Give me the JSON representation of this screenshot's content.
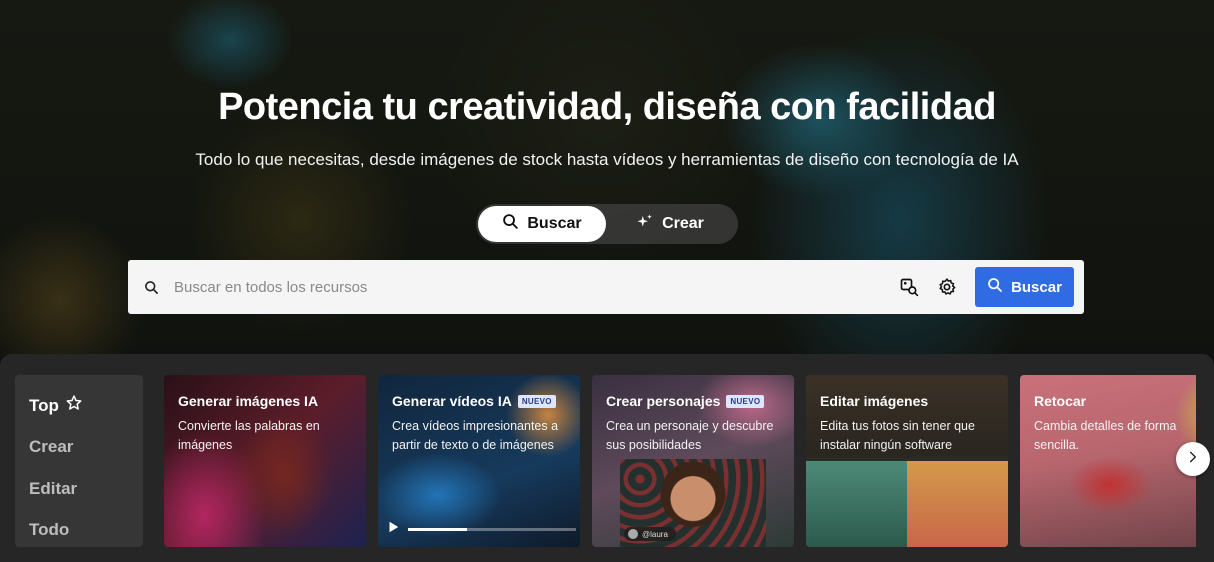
{
  "hero": {
    "title": "Potencia tu creatividad, diseña con facilidad",
    "subtitle": "Todo lo que necesitas, desde imágenes de stock hasta vídeos y herramientas de diseño con tecnología de IA"
  },
  "mode_toggle": {
    "search_label": "Buscar",
    "create_label": "Crear",
    "active": "Buscar"
  },
  "search": {
    "placeholder": "Buscar en todos los recursos",
    "value": "",
    "button_label": "Buscar",
    "button_color": "#2f6be3"
  },
  "categories": [
    {
      "label": "Top",
      "active": true
    },
    {
      "label": "Crear",
      "active": false
    },
    {
      "label": "Editar",
      "active": false
    },
    {
      "label": "Todo",
      "active": false
    }
  ],
  "cards": [
    {
      "title": "Generar imágenes IA",
      "badge": "",
      "description": "Convierte las palabras en imágenes"
    },
    {
      "title": "Generar vídeos IA",
      "badge": "NUEVO",
      "description": "Crea vídeos impresionantes a partir de texto o de imágenes",
      "video_progress": 0.35
    },
    {
      "title": "Crear personajes",
      "badge": "NUEVO",
      "description": "Crea un personaje y descubre sus posibilidades",
      "mention": "@laura"
    },
    {
      "title": "Editar imágenes",
      "badge": "",
      "description": "Edita tus fotos sin tener que instalar ningún software"
    },
    {
      "title": "Retocar",
      "badge": "",
      "description": "Cambia detalles de forma sencilla."
    }
  ],
  "icons": {
    "search": "search-icon",
    "sparkle": "sparkle-icon",
    "image_search": "image-search-icon",
    "settings": "gear-icon",
    "star": "star-icon",
    "play": "play-icon",
    "next": "chevron-right-icon"
  }
}
